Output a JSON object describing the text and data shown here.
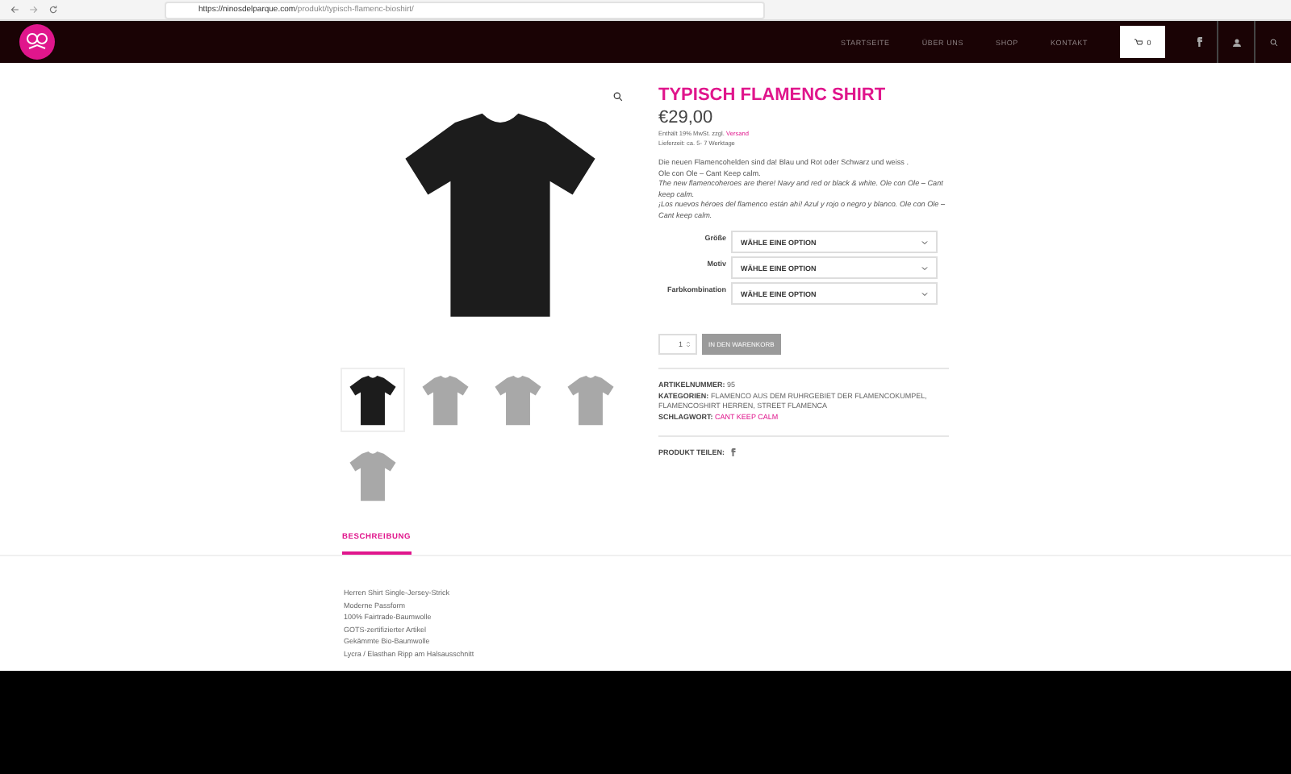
{
  "browser": {
    "url_host": "https://ninosdelparque.com",
    "url_path": "/produkt/typisch-flamenc-bioshirt/"
  },
  "nav": {
    "items": [
      "STARTSEITE",
      "ÜBER UNS",
      "SHOP",
      "KONTAKT"
    ],
    "cart_count": "0"
  },
  "product": {
    "title": "TYPISCH FLAMENC SHIRT",
    "price": "€29,00",
    "tax_note": "Enthält 19% MwSt. zzgl.",
    "shipping_link": "Versand",
    "delivery": "Lieferzeit: ca. 5- 7 Werktage",
    "description": [
      {
        "text": "Die neuen Flamencohelden sind da! Blau und Rot oder Schwarz und weiss .",
        "italic": false
      },
      {
        "text": "Ole con Ole – Cant Keep calm.",
        "italic": false
      },
      {
        "text": "The new flamencoheroes are there! Navy and red or black & white. Ole con Ole – Cant keep calm.",
        "italic": true
      },
      {
        "text": "¡Los nuevos héroes del flamenco están ahí! Azul y rojo o negro y blanco. Ole con Ole –  Cant keep calm.",
        "italic": true
      }
    ],
    "options": [
      {
        "label": "Größe",
        "placeholder": "WÄHLE EINE OPTION"
      },
      {
        "label": "Motiv",
        "placeholder": "WÄHLE EINE OPTION"
      },
      {
        "label": "Farbkombination",
        "placeholder": "WÄHLE EINE OPTION"
      }
    ],
    "quantity": "1",
    "add_to_cart": "IN DEN WARENKORB",
    "add_to_cart_disabled": true,
    "meta": [
      {
        "label": "ARTIKELNUMMER:",
        "value": "95",
        "link": false
      },
      {
        "label": "KATEGORIEN:",
        "value": "FLAMENCO AUS DEM RUHRGEBIET DER FLAMENCOKUMPEL, FLAMENCOSHIRT HERREN, STREET FLAMENCA",
        "link": false
      },
      {
        "label": "SCHLAGWORT:",
        "value": "CANT KEEP CALM",
        "link": true
      }
    ],
    "share_label": "PRODUKT TEILEN:"
  },
  "thumbnails": [
    {
      "color": "#1c1c1c",
      "selected": true
    },
    {
      "color": "#9a9a9a",
      "selected": false
    },
    {
      "color": "#9a9a9a",
      "selected": false
    },
    {
      "color": "#9a9a9a",
      "selected": false
    },
    {
      "color": "#9a9a9a",
      "selected": false
    }
  ],
  "tabs": [
    {
      "label": "BESCHREIBUNG",
      "selected": true
    }
  ],
  "details": [
    "Herren Shirt Single-Jersey-Strick",
    "Moderne Passform",
    "100% Fairtrade-Baumwolle",
    "GOTS-zertifizierter Artikel",
    "Gekämmte Bio-Baumwolle",
    "Lycra / Elasthan Ripp am Halsausschnitt"
  ]
}
